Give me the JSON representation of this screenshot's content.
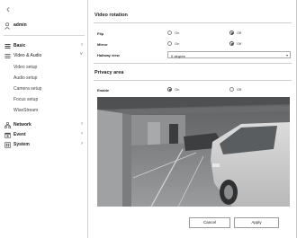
{
  "sidebar": {
    "back_icon": "chevron-left-icon",
    "user": {
      "icon": "user-icon",
      "name": "admin"
    },
    "menu": [
      {
        "label": "Basic",
        "icon": "grid-icon",
        "expanded": false
      },
      {
        "label": "Video & Audio",
        "icon": "menu-lines-icon",
        "expanded": true,
        "children": [
          "Video setup",
          "Audio setup",
          "Camera setup",
          "Focus setup",
          "WiseStream"
        ]
      },
      {
        "label": "Network",
        "icon": "network-icon",
        "expanded": false
      },
      {
        "label": "Event",
        "icon": "event-icon",
        "expanded": false
      },
      {
        "label": "System",
        "icon": "system-icon",
        "expanded": false
      }
    ]
  },
  "video_rotation": {
    "title": "Video rotation",
    "flip": {
      "label": "Flip",
      "on_label": "On",
      "off_label": "Off",
      "value": "Off"
    },
    "mirror": {
      "label": "Mirror",
      "on_label": "On",
      "off_label": "Off",
      "value": "Off"
    },
    "hallway_view": {
      "label": "Hallway view",
      "value": "0 degree"
    }
  },
  "privacy_area": {
    "title": "Privacy area",
    "enable": {
      "label": "Enable",
      "on_label": "On",
      "off_label": "Off",
      "value": "On"
    }
  },
  "buttons": {
    "cancel": "Cancel",
    "apply": "Apply"
  },
  "colors": {
    "accent": "#222222",
    "border": "#cfcfcf"
  }
}
